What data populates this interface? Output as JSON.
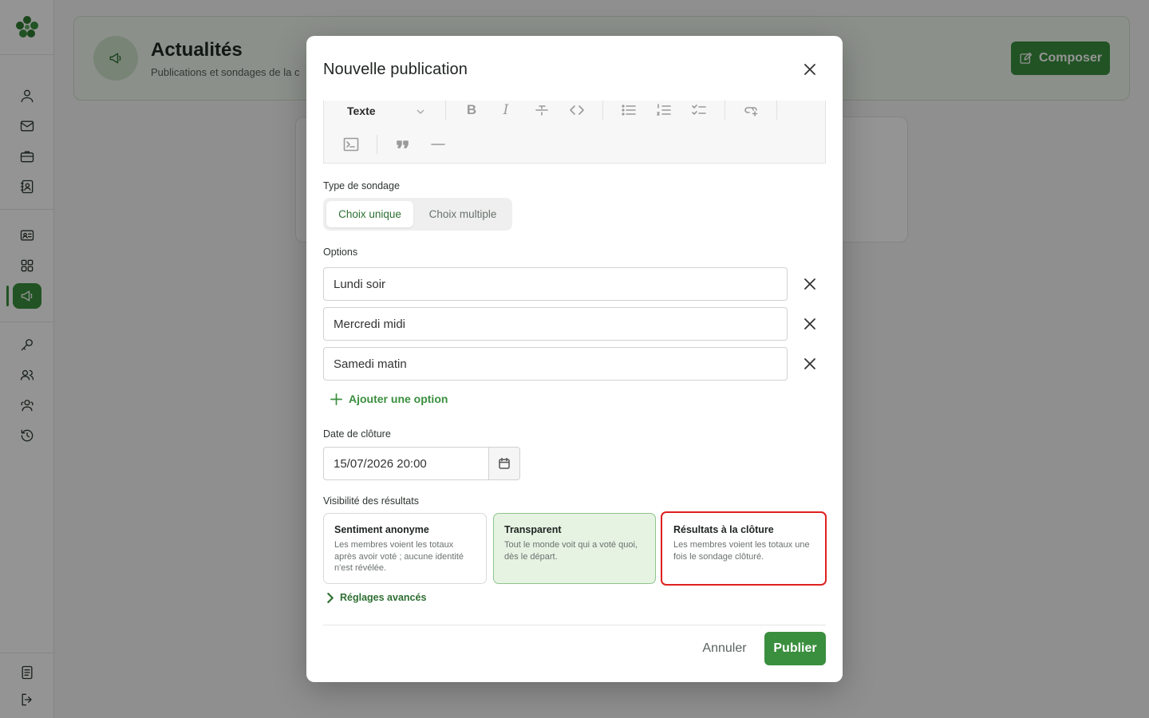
{
  "header": {
    "title": "Actualités",
    "subtitle": "Publications et sondages de la c",
    "compose_label": "Composer"
  },
  "sidebar": {
    "icons": [
      "user-icon",
      "mail-icon",
      "briefcase-icon",
      "contact-book-icon",
      "id-card-icon",
      "grid-icon",
      "megaphone-icon",
      "key-icon",
      "users-icon",
      "team-icon",
      "history-icon",
      "document-icon",
      "logout-icon"
    ],
    "active": "megaphone-icon"
  },
  "modal": {
    "title": "Nouvelle publication",
    "toolbar": {
      "text_style": "Texte",
      "buttons": [
        "bold",
        "italic",
        "strikethrough",
        "code",
        "bullet-list",
        "numbered-list",
        "task-list",
        "link",
        "code-block",
        "quote",
        "horizontal-rule"
      ]
    },
    "poll_type": {
      "label": "Type de sondage",
      "options": [
        "Choix unique",
        "Choix multiple"
      ],
      "selected": "Choix unique"
    },
    "options": {
      "label": "Options",
      "items": [
        {
          "value": "Lundi soir"
        },
        {
          "value": "Mercredi midi"
        },
        {
          "value": "Samedi matin"
        }
      ],
      "add_label": "Ajouter une option"
    },
    "closing_date": {
      "label": "Date de clôture",
      "value": "15/07/2026 20:00"
    },
    "visibility": {
      "label": "Visibilité des résultats",
      "cards": [
        {
          "title": "Sentiment anonyme",
          "description": "Les membres voient les totaux après avoir voté ; aucune identité n'est révélée."
        },
        {
          "title": "Transparent",
          "description": "Tout le monde voit qui a voté quoi, dès le départ."
        },
        {
          "title": "Résultats à la clôture",
          "description": "Les membres voient les totaux une fois le sondage clôturé."
        }
      ]
    },
    "advanced_label": "Réglages avancés",
    "cancel_label": "Annuler",
    "publish_label": "Publier"
  },
  "colors": {
    "accent": "#3a8f3e",
    "selected_card_bg": "#e6f3e3",
    "focus_outline": "#e02020"
  }
}
